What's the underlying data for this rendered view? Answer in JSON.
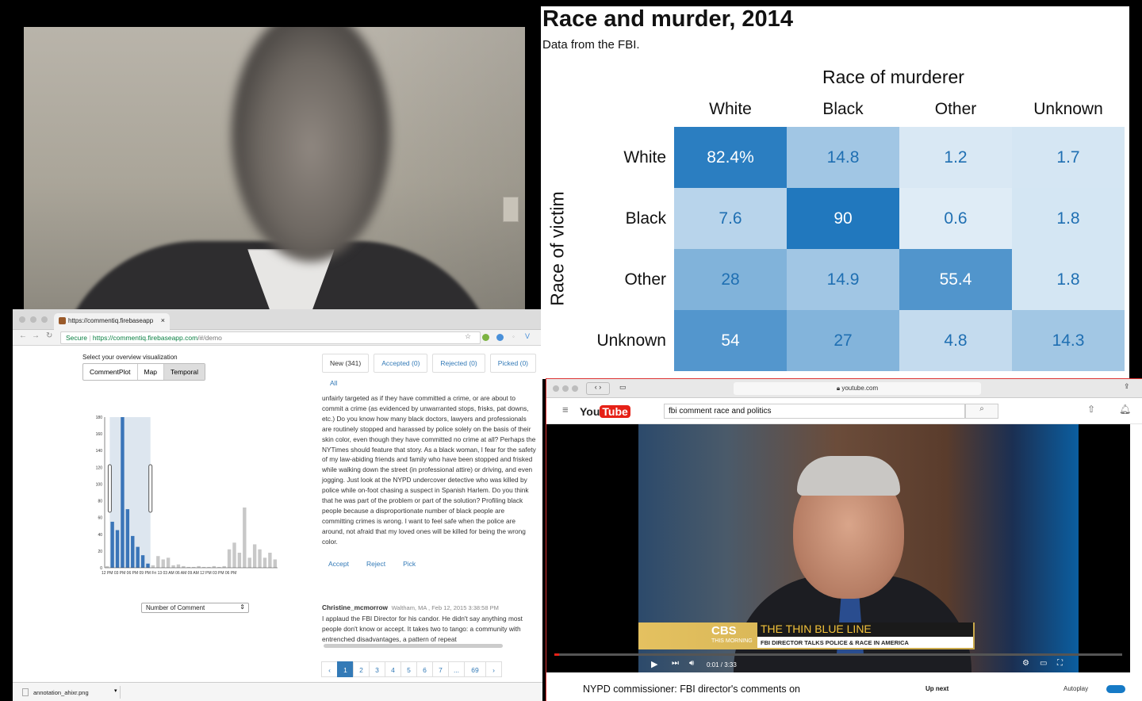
{
  "browser": {
    "tab_title": "https://commentiq.firebaseapp",
    "secure_label": "Secure",
    "url_host": "https://commentiq.firebaseapp.com",
    "url_path": "/#/demo",
    "overview_label": "Select your overview visualization",
    "viz_buttons": [
      "CommentPlot",
      "Map",
      "Temporal"
    ],
    "chart_yticks": [
      "180",
      "160",
      "140",
      "120",
      "100",
      "80",
      "60",
      "40",
      "20",
      "0"
    ],
    "chart_xticks": "12 PM 03 PM 06 PM 09 PM Fri 13 03 AM 06 AM 09 AM 12 PM 03 PM 06 PM",
    "metric_select": "Number of Comment",
    "tabs": [
      "New (341)",
      "Accepted (0)",
      "Rejected (0)",
      "Picked (0)"
    ],
    "all_label": "All",
    "comment_text": "unfairly targeted as if they have committed a crime, or are about to commit a crime (as evidenced by unwarranted stops, frisks, pat downs, etc.) Do you know how many black doctors, lawyers and professionals are routinely stopped and harassed by police solely on the basis of their skin color, even though they have committed no crime at all? Perhaps the NYTimes should feature that story. As a black woman, I fear for the safety of my law-abiding friends and family who have been stopped and frisked while walking down the street (in professional attire) or driving, and even jogging. Just look at the NYPD undercover detective who was killed by police while on-foot chasing a suspect in Spanish Harlem. Do you think that he was part of the problem or part of the solution? Profiling black people because a disproportionate number of black people are committing crimes is wrong. I want to feel safe when the police are around, not afraid that my loved ones will be killed for being the wrong color.",
    "actions": [
      "Accept",
      "Reject",
      "Pick"
    ],
    "author_name": "Christine_mcmorrow",
    "author_meta": "Waltham, MA , Feb 12, 2015 3:38:58 PM",
    "author_text": "I applaud the FBI Director for his candor. He didn't say anything most people don't know or accept. It takes two to tango: a community with entrenched disadvantages, a pattern of repeat",
    "pages": [
      "‹",
      "1",
      "2",
      "3",
      "4",
      "5",
      "6",
      "7",
      "...",
      "69",
      "›"
    ],
    "download_file": "annotation_ahixr.png"
  },
  "chart_data": [
    {
      "type": "bar",
      "title": "",
      "yticks": [
        0,
        20,
        40,
        60,
        80,
        100,
        120,
        140,
        160,
        180
      ],
      "ylim": [
        0,
        180
      ],
      "values": [
        2,
        55,
        45,
        180,
        70,
        38,
        25,
        15,
        5,
        3,
        14,
        10,
        12,
        3,
        4,
        2,
        1,
        1,
        2,
        1,
        1,
        2,
        1,
        2,
        22,
        30,
        18,
        72,
        12,
        28,
        22,
        12,
        18,
        10
      ],
      "highlight_range": [
        1,
        8
      ]
    },
    {
      "type": "heatmap",
      "title": "Race and murder, 2014",
      "subtitle": "Data from the FBI.",
      "xlabel": "Race of murderer",
      "ylabel": "Race of victim",
      "columns": [
        "White",
        "Black",
        "Other",
        "Unknown"
      ],
      "rows": [
        "White",
        "Black",
        "Other",
        "Unknown"
      ],
      "values": [
        [
          "82.4%",
          "14.8",
          "1.2",
          "1.7"
        ],
        [
          "7.6",
          "90",
          "0.6",
          "1.8"
        ],
        [
          "28",
          "14.9",
          "55.4",
          "1.8"
        ],
        [
          "54",
          "27",
          "4.8",
          "14.3"
        ]
      ],
      "numeric": [
        [
          82.4,
          14.8,
          1.2,
          1.7
        ],
        [
          7.6,
          90,
          0.6,
          1.8
        ],
        [
          28,
          14.9,
          55.4,
          1.8
        ],
        [
          54,
          27,
          4.8,
          14.3
        ]
      ]
    }
  ],
  "youtube": {
    "url": "youtube.com",
    "logo_you": "You",
    "logo_tube": "Tube",
    "search_query": "fbi comment race and politics",
    "brand": "CBS",
    "brand_sub": "THIS MORNING",
    "headline": "THE THIN BLUE LINE",
    "subheadline": "FBI DIRECTOR TALKS POLICE & RACE IN AMERICA",
    "time": "0:01 / 3:33",
    "video_title": "NYPD commissioner: FBI director's comments on",
    "up_next": "Up next",
    "autoplay": "Autoplay"
  }
}
